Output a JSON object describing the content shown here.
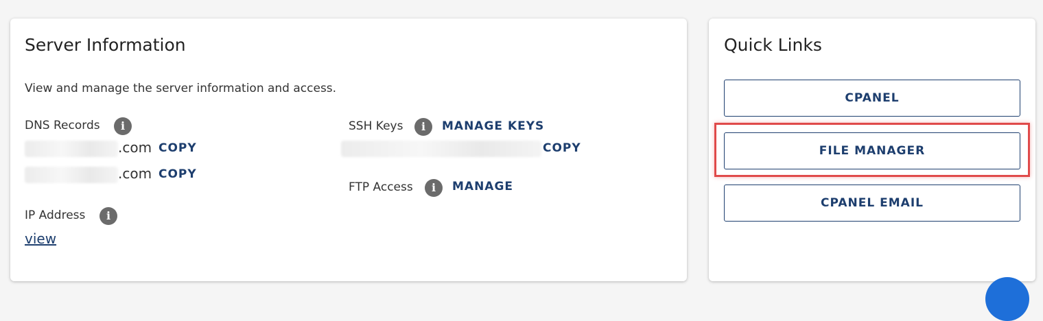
{
  "server": {
    "title": "Server Information",
    "description": "View and manage the server information and access.",
    "dns_label": "DNS Records",
    "dns_records": [
      {
        "suffix": ".com",
        "copy_label": "COPY"
      },
      {
        "suffix": ".com",
        "copy_label": "COPY"
      }
    ],
    "ip_label": "IP Address",
    "ip_link": "view",
    "ssh_label": "SSH Keys",
    "ssh_manage": "MANAGE KEYS",
    "ssh_copy": "COPY",
    "ftp_label": "FTP Access",
    "ftp_manage": "MANAGE",
    "info_glyph": "i"
  },
  "quick_links": {
    "title": "Quick Links",
    "buttons": [
      "CPANEL",
      "FILE MANAGER",
      "CPANEL EMAIL"
    ],
    "highlighted": "FILE MANAGER"
  },
  "colors": {
    "accent": "#1d3e6e",
    "highlight": "#e04a4a",
    "info_icon": "#6b6b6b",
    "fab": "#1e6fd9"
  }
}
